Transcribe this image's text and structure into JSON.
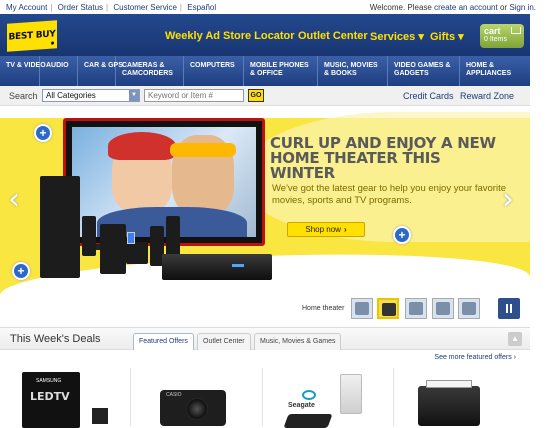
{
  "utility": {
    "links": [
      "My Account",
      "Order Status",
      "Customer Service",
      "Español"
    ],
    "welcome": "Welcome. Please",
    "create_account": "create an account",
    "or": "or",
    "sign_in": "Sign in."
  },
  "header": {
    "logo_text": "BEST BUY",
    "nav": [
      "Weekly Ad",
      "Store Locator",
      "Outlet Center",
      "Services ▾",
      "Gifts ▾"
    ],
    "cart_title": "cart",
    "cart_items": "0 Items"
  },
  "categories": [
    "TV & VIDEO",
    "AUDIO",
    "CAR & GPS",
    "CAMERAS & CAMCORDERS",
    "COMPUTERS",
    "MOBILE PHONES & OFFICE",
    "MUSIC, MOVIES & BOOKS",
    "VIDEO GAMES & GADGETS",
    "HOME & APPLIANCES"
  ],
  "search": {
    "label": "Search",
    "category_value": "All Categories",
    "placeholder": "Keyword or Item #",
    "go": "GO",
    "credit_cards": "Credit Cards",
    "reward_zone": "Reward Zone"
  },
  "hero": {
    "headline": "CURL UP AND ENJOY A NEW HOME THEATER THIS WINTER",
    "subtext": "We've got the latest gear to help you enjoy your favorite movies, sports and TV programs.",
    "shop_now": "Shop now",
    "prev": "‹",
    "next": "›",
    "plus": "+"
  },
  "carousel": {
    "current_label": "Home theater",
    "thumb_count": 6,
    "active_index": 1
  },
  "deals": {
    "title": "This Week's Deals",
    "tabs": [
      "Featured Offers",
      "Outlet Center",
      "Music, Movies & Games"
    ],
    "active_tab": 0,
    "see_more": "See more featured offers ›",
    "products": [
      {
        "name": "Samsung LED TV",
        "brand_label": "SAMSUNG",
        "model_label": "LEDTV"
      },
      {
        "name": "Casio digital camera",
        "brand_label": "CASIO"
      },
      {
        "name": "Seagate external drive",
        "brand_label": "Seagate"
      },
      {
        "name": "Epson all-in-one printer"
      }
    ]
  },
  "colors": {
    "brand_blue": "#1a3a7a",
    "brand_yellow": "#ffe000",
    "hero_yellow": "#f9e640",
    "link_blue": "#1d3c7a"
  }
}
